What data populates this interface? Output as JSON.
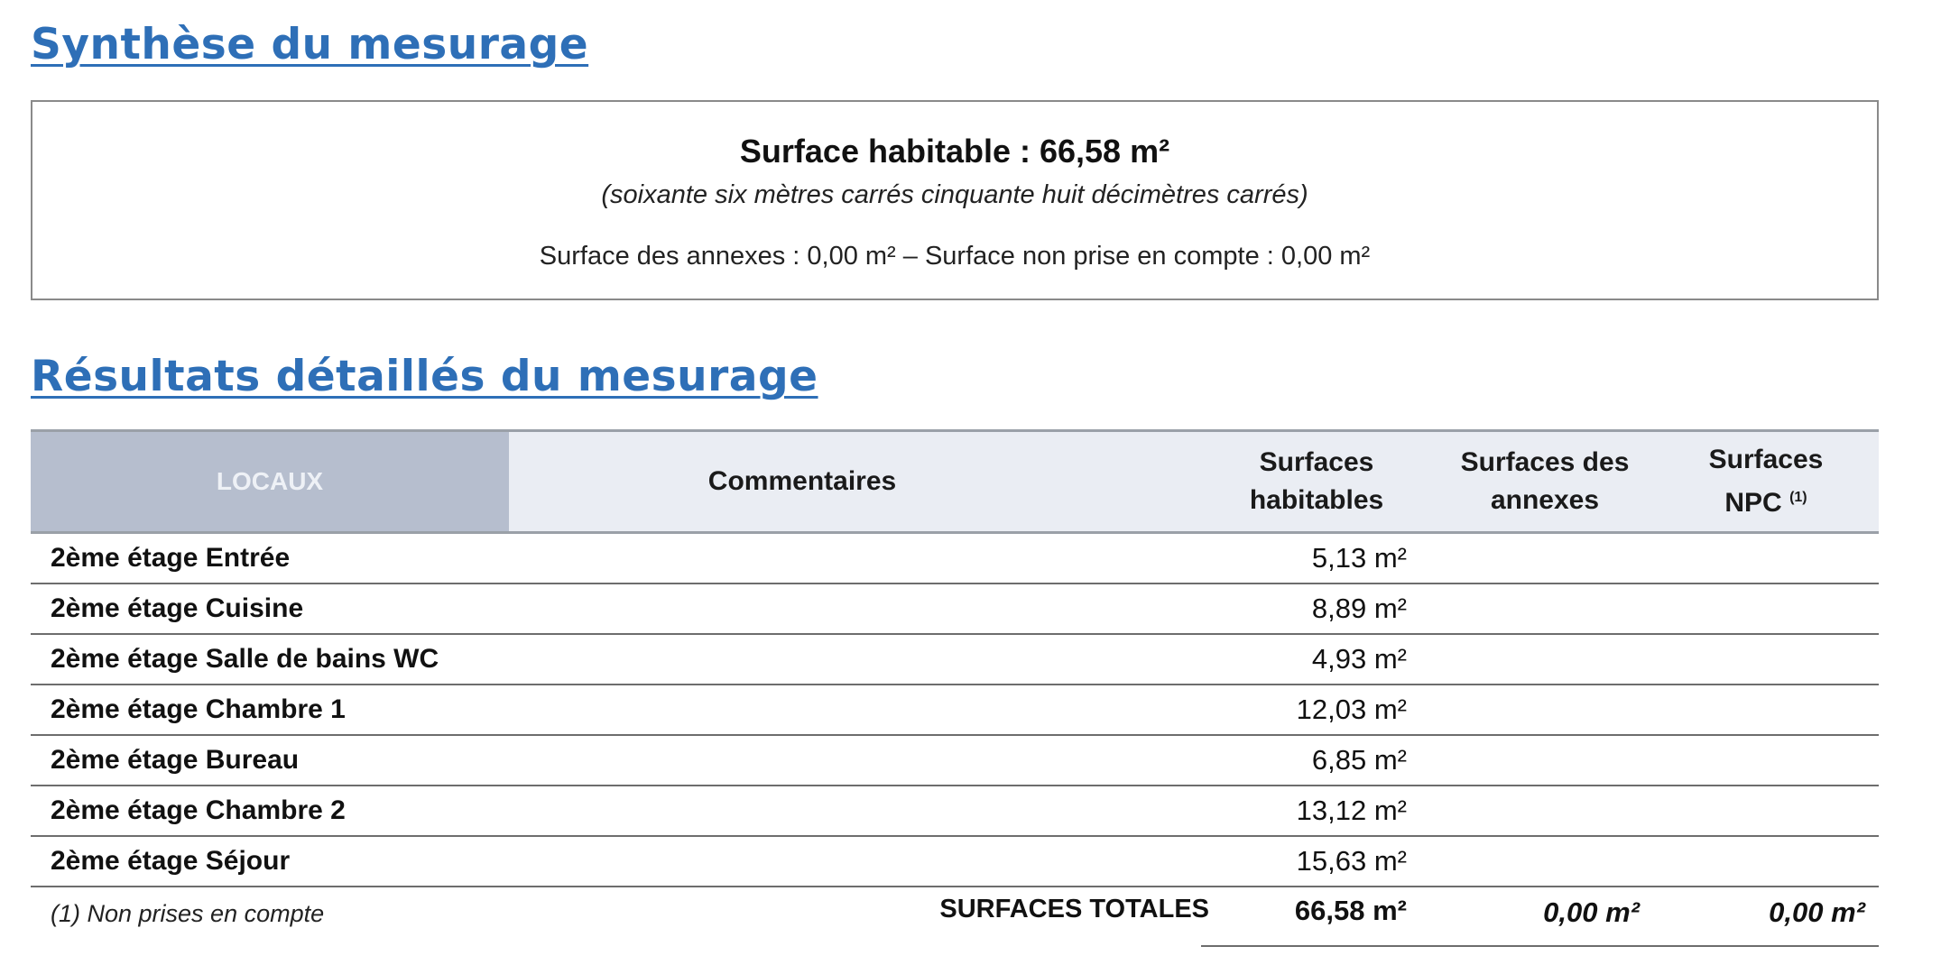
{
  "section1": {
    "title": "Synthèse du mesurage"
  },
  "summary": {
    "main": "Surface habitable : 66,58 m²",
    "words": "(soixante six  mètres carrés cinquante  huit  décimètres carrés)",
    "annexes": "Surface des annexes : 0,00 m² – Surface non prise en compte : 0,00 m²"
  },
  "section2": {
    "title": "Résultats détaillés du mesurage"
  },
  "table": {
    "headers": {
      "locaux": "LOCAUX",
      "commentaires": "Commentaires",
      "hab_line1": "Surfaces",
      "hab_line2": "habitables",
      "ann_line1": "Surfaces des",
      "ann_line2": "annexes",
      "npc_line1": "Surfaces",
      "npc_line2": "NPC",
      "npc_note": "(1)"
    },
    "rows": [
      {
        "name": "2ème étage Entrée",
        "hab": "5,13 m²"
      },
      {
        "name": "2ème étage Cuisine",
        "hab": "8,89 m²"
      },
      {
        "name": "2ème étage Salle de bains WC",
        "hab": "4,93 m²"
      },
      {
        "name": "2ème étage Chambre 1",
        "hab": "12,03 m²"
      },
      {
        "name": "2ème étage Bureau",
        "hab": "6,85 m²"
      },
      {
        "name": "2ème étage Chambre 2",
        "hab": "13,12 m²"
      },
      {
        "name": "2ème étage Séjour",
        "hab": "15,63 m²"
      }
    ],
    "footer": {
      "note": "(1)   Non prises en compte",
      "total_label": "SURFACES TOTALES",
      "total_hab": "66,58 m²",
      "total_ann": "0,00 m²",
      "total_npc": "0,00 m²"
    }
  }
}
